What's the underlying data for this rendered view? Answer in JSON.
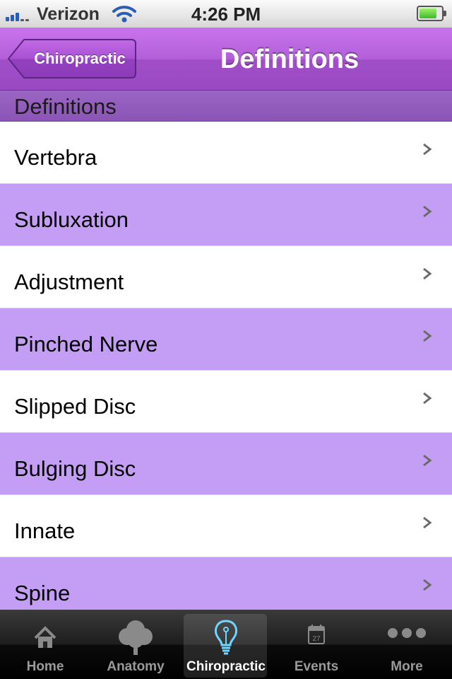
{
  "status_bar": {
    "carrier": "Verizon",
    "time": "4:26 PM",
    "battery_level": 0.8
  },
  "nav": {
    "back_label": "Chiropractic",
    "title": "Definitions"
  },
  "section": {
    "header": "Definitions"
  },
  "list": {
    "items": [
      {
        "label": "Vertebra"
      },
      {
        "label": "Subluxation"
      },
      {
        "label": "Adjustment"
      },
      {
        "label": "Pinched Nerve"
      },
      {
        "label": "Slipped Disc"
      },
      {
        "label": "Bulging Disc"
      },
      {
        "label": "Innate"
      },
      {
        "label": "Spine"
      }
    ]
  },
  "tab_bar": {
    "tabs": [
      {
        "label": "Home",
        "icon": "home-icon"
      },
      {
        "label": "Anatomy",
        "icon": "tree-icon"
      },
      {
        "label": "Chiropractic",
        "icon": "lightbulb-icon",
        "active": true
      },
      {
        "label": "Events",
        "icon": "calendar-icon",
        "calendar_day": "27"
      },
      {
        "label": "More",
        "icon": "more-icon"
      }
    ]
  },
  "colors": {
    "nav_purple": "#b25fd9",
    "row_lavender": "#c49ef5",
    "section_purple": "#8b55b6",
    "active_tab_icon": "#6fd6ff"
  }
}
